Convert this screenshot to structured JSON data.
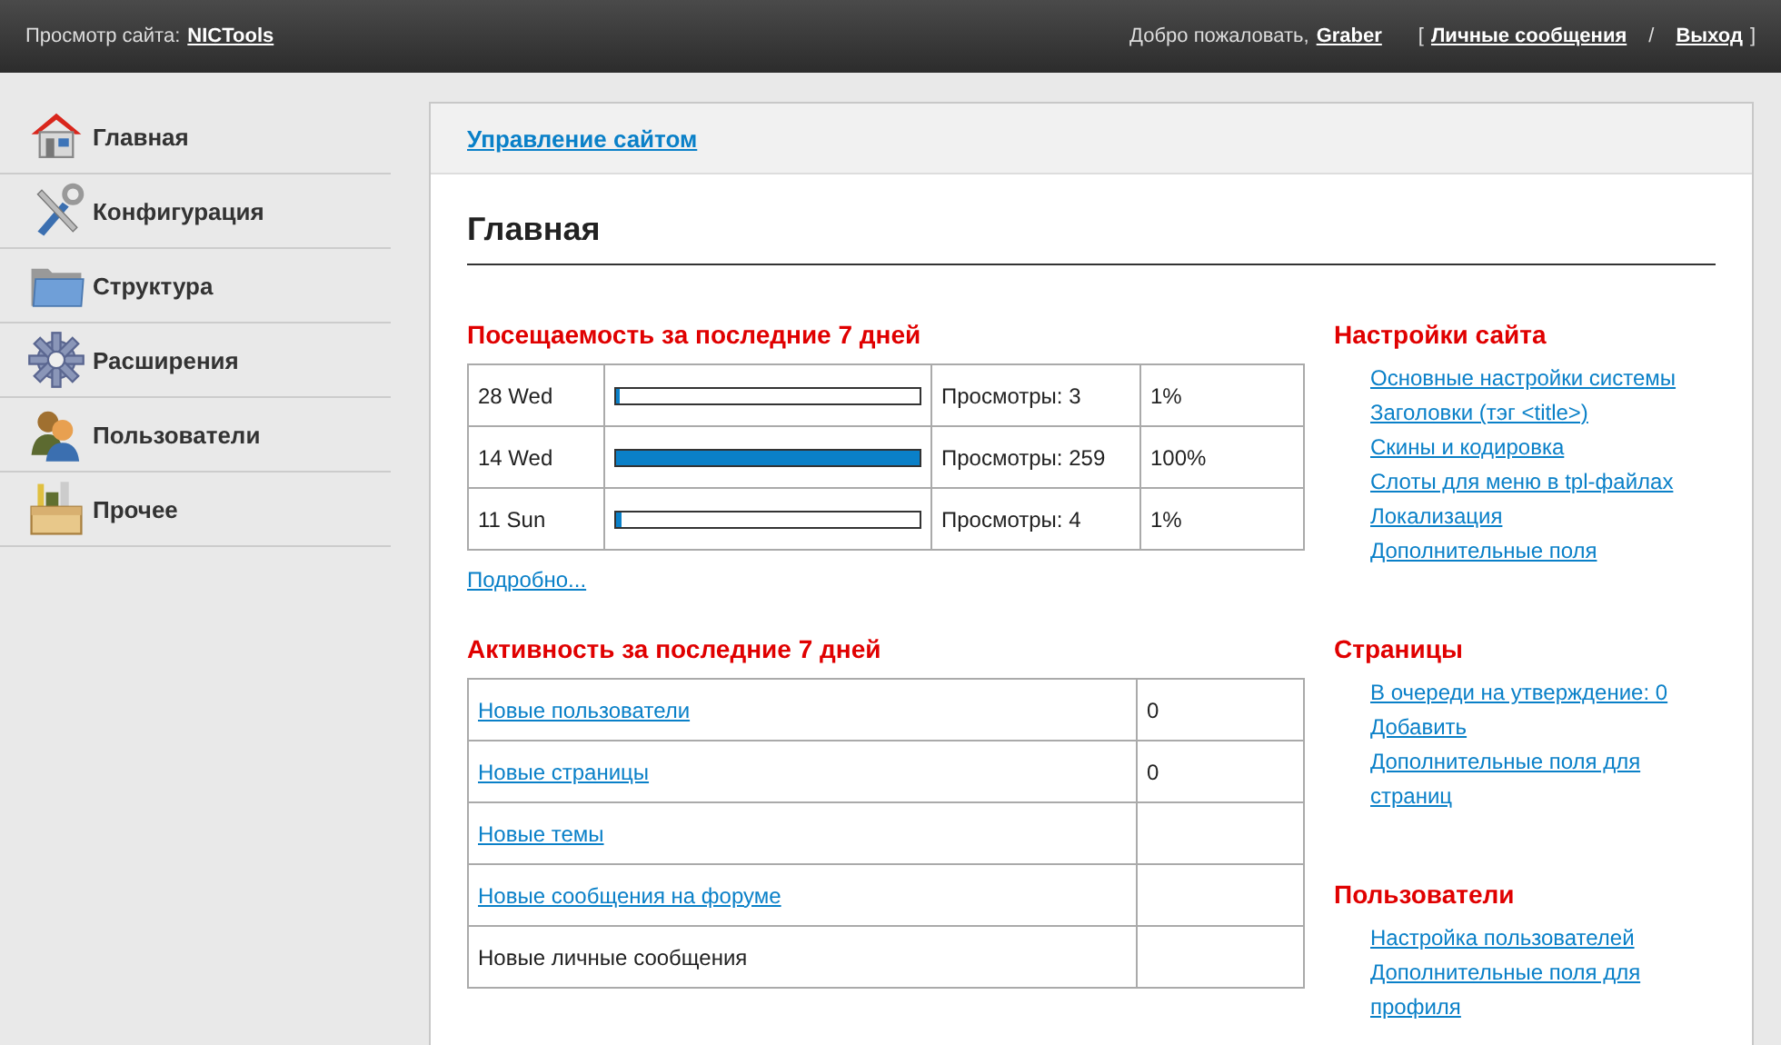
{
  "header": {
    "site_label": "Просмотр сайта:",
    "site_link": "NICTools",
    "welcome": "Добро пожаловать,",
    "user": "Graber",
    "bracket_open": "[",
    "messages_link": "Личные сообщения",
    "separator": "/",
    "logout_link": "Выход",
    "bracket_close": "]"
  },
  "sidebar": {
    "items": [
      {
        "label": "Главная"
      },
      {
        "label": "Конфигурация"
      },
      {
        "label": "Структура"
      },
      {
        "label": "Расширения"
      },
      {
        "label": "Пользователи"
      },
      {
        "label": "Прочее"
      }
    ]
  },
  "panel": {
    "breadcrumb": "Управление сайтом",
    "title": "Главная"
  },
  "visits": {
    "heading": "Посещаемость за последние 7 дней",
    "rows": [
      {
        "date": "28 Wed",
        "level": 0.012,
        "views": "Просмотры: 3",
        "percent": "1%"
      },
      {
        "date": "14 Wed",
        "level": 1,
        "views": "Просмотры: 259",
        "percent": "100%"
      },
      {
        "date": "11 Sun",
        "level": 0.015,
        "views": "Просмотры: 4",
        "percent": "1%"
      }
    ],
    "more_link": "Подробно..."
  },
  "activity": {
    "heading": "Активность за последние 7 дней",
    "rows": [
      {
        "label": "Новые пользователи",
        "kind": "link",
        "value": "0"
      },
      {
        "label": "Новые страницы",
        "kind": "link",
        "value": "0"
      },
      {
        "label": "Новые темы",
        "kind": "link"
      },
      {
        "label": "Новые сообщения на форуме",
        "kind": "link"
      },
      {
        "label": "Новые личные сообщения",
        "kind": "text"
      }
    ]
  },
  "sections": [
    {
      "heading": "Настройки сайта",
      "links": [
        "Основные настройки системы",
        "Заголовки (тэг <title>)",
        "Скины и кодировка",
        "Слоты для меню в tpl-файлах",
        "Локализация",
        "Дополнительные поля"
      ]
    },
    {
      "heading": "Страницы",
      "links": [
        "В очереди на утверждение: 0",
        "Добавить",
        "Дополнительные поля для страниц"
      ]
    },
    {
      "heading": "Пользователи",
      "links": [
        "Настройка пользователей",
        "Дополнительные поля для профиля"
      ]
    }
  ]
}
